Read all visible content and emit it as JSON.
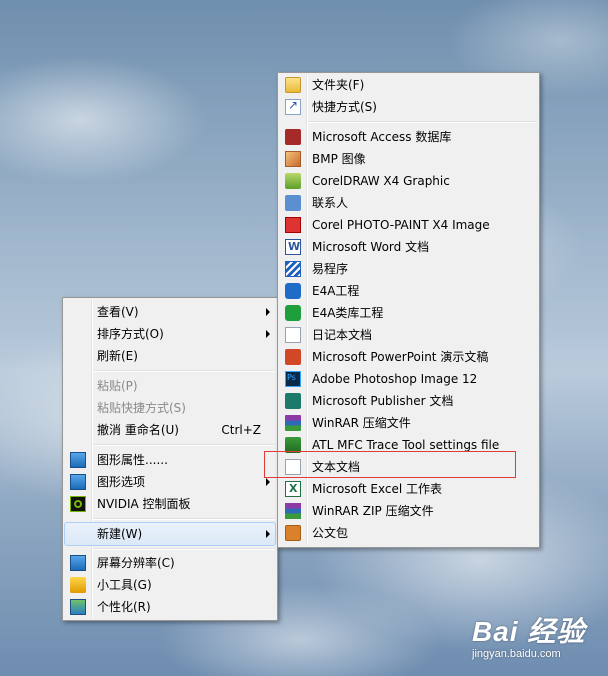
{
  "context_menu": {
    "items": [
      {
        "label": "查看(V)",
        "icon": "",
        "submenu": true
      },
      {
        "label": "排序方式(O)",
        "icon": "",
        "submenu": true
      },
      {
        "label": "刷新(E)",
        "icon": ""
      },
      {
        "label": "粘贴(P)",
        "icon": "",
        "disabled": true
      },
      {
        "label": "粘贴快捷方式(S)",
        "icon": "",
        "disabled": true
      },
      {
        "label": "撤消 重命名(U)",
        "icon": "",
        "shortcut": "Ctrl+Z"
      },
      {
        "label": "图形属性......",
        "icon": "intel-graphics-icon"
      },
      {
        "label": "图形选项",
        "icon": "intel-graphics-icon",
        "submenu": true
      },
      {
        "label": "NVIDIA 控制面板",
        "icon": "nvidia-icon"
      },
      {
        "label": "新建(W)",
        "icon": "",
        "submenu": true,
        "highlighted": true
      },
      {
        "label": "屏幕分辨率(C)",
        "icon": "display-icon"
      },
      {
        "label": "小工具(G)",
        "icon": "gadget-icon"
      },
      {
        "label": "个性化(R)",
        "icon": "personalize-icon"
      }
    ]
  },
  "new_submenu": {
    "items": [
      {
        "label": "文件夹(F)",
        "icon": "folder-icon"
      },
      {
        "label": "快捷方式(S)",
        "icon": "shortcut-icon"
      },
      {
        "label": "Microsoft Access 数据库",
        "icon": "access-icon"
      },
      {
        "label": "BMP 图像",
        "icon": "bmp-icon"
      },
      {
        "label": "CorelDRAW X4 Graphic",
        "icon": "coreldraw-icon"
      },
      {
        "label": "联系人",
        "icon": "contact-icon"
      },
      {
        "label": "Corel PHOTO-PAINT X4 Image",
        "icon": "photo-paint-icon"
      },
      {
        "label": "Microsoft Word 文档",
        "icon": "word-icon"
      },
      {
        "label": "易程序",
        "icon": "easy-program-icon"
      },
      {
        "label": "E4A工程",
        "icon": "e4a-project-icon"
      },
      {
        "label": "E4A类库工程",
        "icon": "e4a-library-icon"
      },
      {
        "label": "日记本文档",
        "icon": "journal-icon"
      },
      {
        "label": "Microsoft PowerPoint 演示文稿",
        "icon": "powerpoint-icon"
      },
      {
        "label": "Adobe Photoshop Image 12",
        "icon": "photoshop-icon"
      },
      {
        "label": "Microsoft Publisher 文档",
        "icon": "publisher-icon"
      },
      {
        "label": "WinRAR 压缩文件",
        "icon": "winrar-icon"
      },
      {
        "label": "ATL MFC Trace Tool settings file",
        "icon": "atl-trace-icon"
      },
      {
        "label": "文本文档",
        "icon": "text-document-icon",
        "boxed": true
      },
      {
        "label": "Microsoft Excel 工作表",
        "icon": "excel-icon"
      },
      {
        "label": "WinRAR ZIP 压缩文件",
        "icon": "winrar-zip-icon"
      },
      {
        "label": "公文包",
        "icon": "briefcase-icon"
      }
    ]
  },
  "watermark": {
    "brand": "Bai 经验",
    "url": "jingyan.baidu.com"
  },
  "colors": {
    "menu_bg": "#f0f0f0",
    "highlight_box": "#e23a3a",
    "highlight_row": "#dbe8f7"
  }
}
